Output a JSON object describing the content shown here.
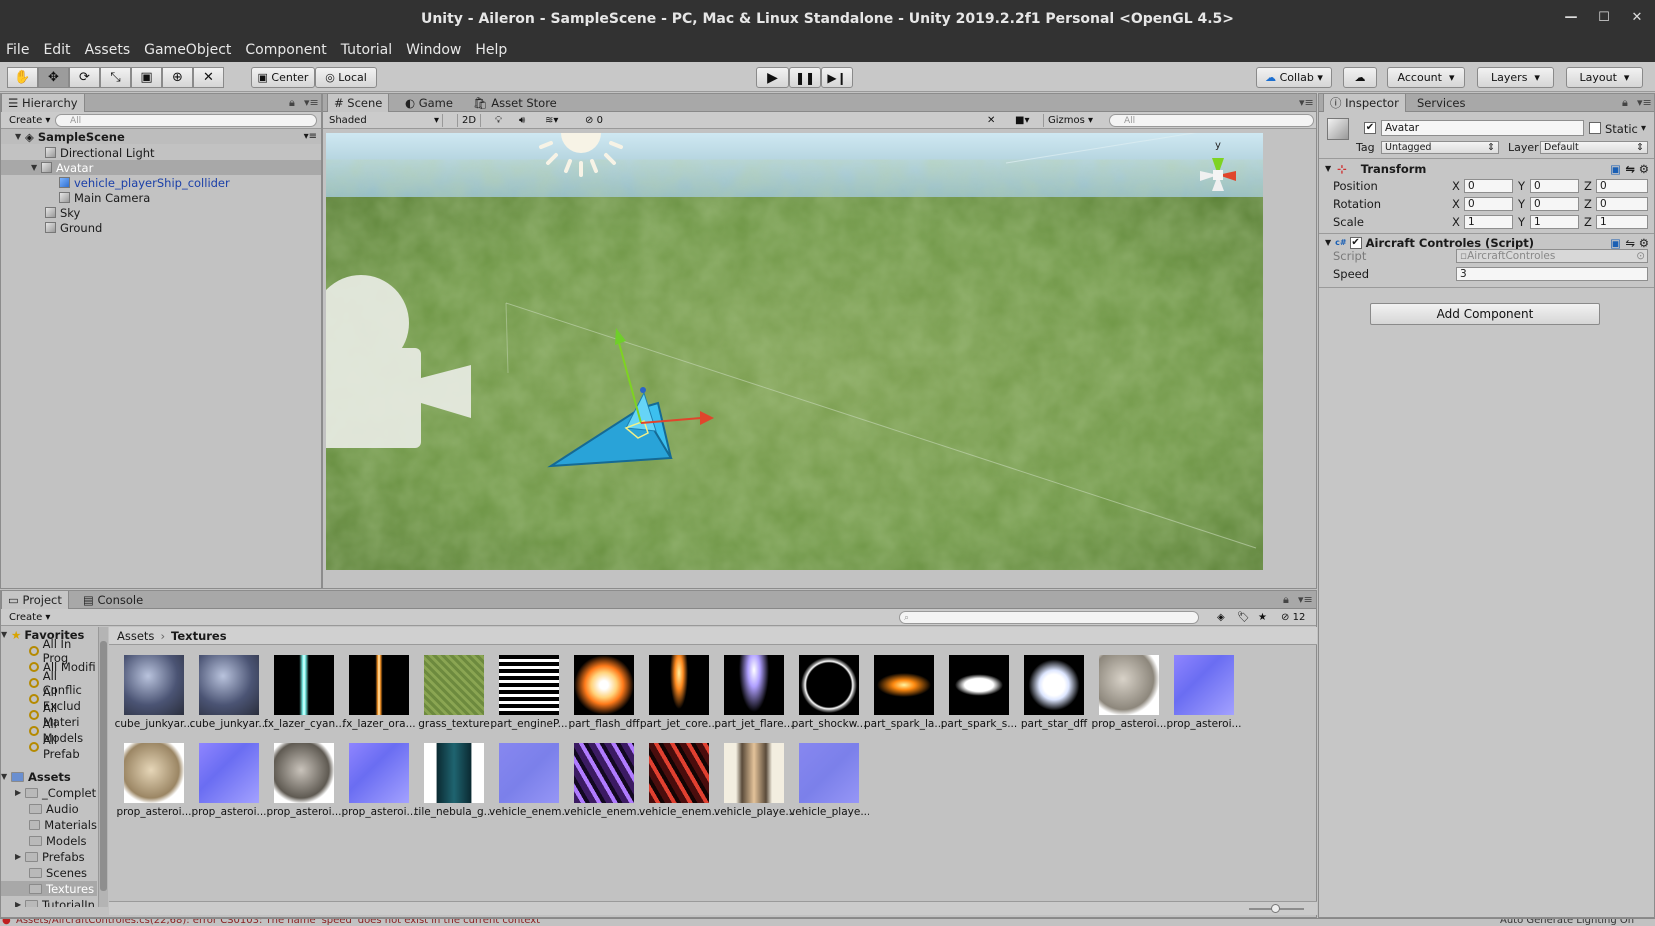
{
  "window": {
    "title": "Unity - Aileron - SampleScene - PC, Mac & Linux Standalone - Unity 2019.2.2f1 Personal <OpenGL 4.5>"
  },
  "menu": [
    "File",
    "Edit",
    "Assets",
    "GameObject",
    "Component",
    "Tutorial",
    "Window",
    "Help"
  ],
  "toolbar": {
    "pivot": "Center",
    "space": "Local",
    "collab": "Collab",
    "account": "Account",
    "layers": "Layers",
    "layout": "Layout"
  },
  "hierarchy": {
    "tab": "Hierarchy",
    "create": "Create",
    "search": "All",
    "scene": "SampleScene",
    "items": [
      "Directional Light",
      "Avatar",
      "vehicle_playerShip_collider",
      "Main Camera",
      "Sky",
      "Ground"
    ]
  },
  "scene": {
    "tabs": [
      "Scene",
      "Game",
      "Asset Store"
    ],
    "shading": "Shaded",
    "mode2d": "2D",
    "effects_count": "0",
    "gizmos": "Gizmos",
    "search": "All",
    "axis_y": "y"
  },
  "inspector": {
    "tabs": [
      "Inspector",
      "Services"
    ],
    "object_name": "Avatar",
    "static_label": "Static",
    "tag_label": "Tag",
    "tag_value": "Untagged",
    "layer_label": "Layer",
    "layer_value": "Default",
    "transform": {
      "title": "Transform",
      "position": {
        "label": "Position",
        "x": "0",
        "y": "0",
        "z": "0"
      },
      "rotation": {
        "label": "Rotation",
        "x": "0",
        "y": "0",
        "z": "0"
      },
      "scale": {
        "label": "Scale",
        "x": "1",
        "y": "1",
        "z": "1"
      }
    },
    "script": {
      "title": "Aircraft Controles (Script)",
      "script_label": "Script",
      "script_value": "AircraftControles",
      "speed_label": "Speed",
      "speed_value": "3"
    },
    "add_component": "Add Component"
  },
  "project": {
    "tabs": [
      "Project",
      "Console"
    ],
    "create": "Create",
    "hidden_count": "12",
    "breadcrumb": [
      "Assets",
      "Textures"
    ],
    "favorites_title": "Favorites",
    "favorites": [
      "All In Prog",
      "All Modifi",
      "All Conflic",
      "All Exclud",
      "All Materi",
      "All Models",
      "All Prefab"
    ],
    "assets_title": "Assets",
    "folders": [
      "_Complet",
      "Audio",
      "Materials",
      "Models",
      "Prefabs",
      "Scenes",
      "Textures",
      "TutorialIn"
    ],
    "textures": [
      "cube_junkyar...",
      "cube_junkyar...",
      "fx_lazer_cyan...",
      "fx_lazer_ora...",
      "grass_texture",
      "part_engineP...",
      "part_flash_dff",
      "part_jet_core...",
      "part_jet_flare...",
      "part_shockw...",
      "part_spark_la...",
      "part_spark_s...",
      "part_star_dff",
      "prop_asteroi...",
      "prop_asteroi...",
      "prop_asteroi...",
      "prop_asteroi...",
      "prop_asteroi...",
      "prop_asteroi...",
      "tile_nebula_g...",
      "vehicle_enem...",
      "vehicle_enem...",
      "vehicle_enem...",
      "vehicle_playe...",
      "vehicle_playe..."
    ]
  },
  "status": {
    "error": "Assets/AircraftControles.cs(22,68): error CS0103: The name 'speed' does not exist in the current context",
    "right": "Auto Generate Lighting On"
  }
}
